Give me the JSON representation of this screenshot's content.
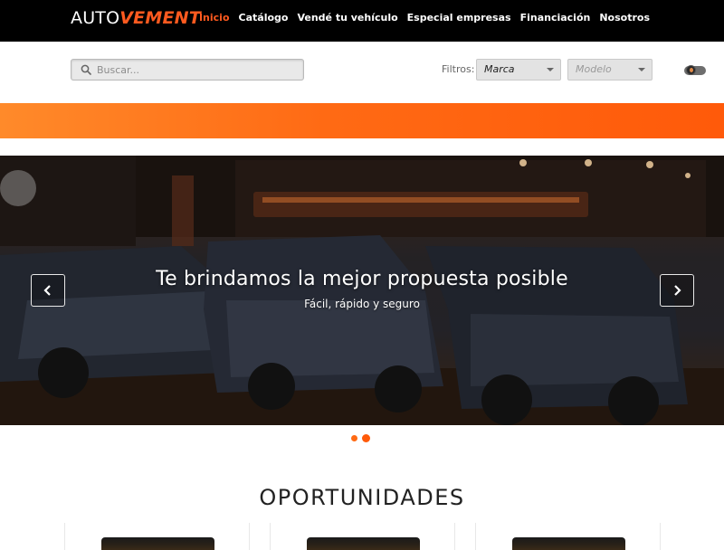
{
  "brand": {
    "logo_part1": "AUTO",
    "logo_part2": "VEMENT",
    "accent": "#ff5a1f"
  },
  "nav": {
    "items": [
      {
        "label": "Inicio",
        "active": true
      },
      {
        "label": "Catálogo"
      },
      {
        "label": "Vendé tu vehículo"
      },
      {
        "label": "Especial empresas"
      },
      {
        "label": "Financiación"
      },
      {
        "label": "Nosotros"
      }
    ]
  },
  "search": {
    "placeholder": "Buscar...",
    "value": "",
    "icon": "search-icon"
  },
  "filters": {
    "label": "Filtros:",
    "marca": {
      "selected": "Marca"
    },
    "modelo": {
      "selected": "Modelo"
    }
  },
  "theme_toggle": {
    "icon": "moon-icon",
    "on": false
  },
  "hero": {
    "title": "Te brindamos la mejor propuesta posible",
    "subtitle": "Fácil, rápido y seguro",
    "prev_icon": "chevron-left-icon",
    "next_icon": "chevron-right-icon",
    "slides_count": 2,
    "active_slide": 1
  },
  "opportunities": {
    "title": "OPORTUNIDADES",
    "cards_visible": 3
  }
}
